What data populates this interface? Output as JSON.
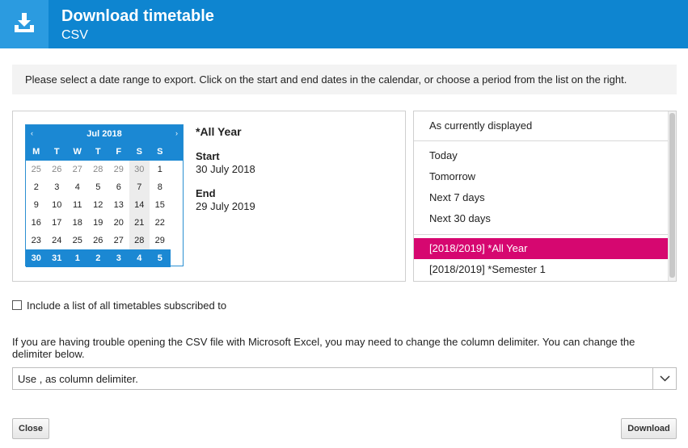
{
  "header": {
    "title": "Download timetable",
    "subtitle": "CSV",
    "icon": "download-tray-icon",
    "color": "#0e85d0"
  },
  "info": {
    "text": "Please select a date range to export. Click on the start and end dates in the calendar, or choose a period from the list on the right."
  },
  "calendar": {
    "month_label": "Jul 2018",
    "prev": "‹",
    "next": "›",
    "days_of_week": [
      "M",
      "T",
      "W",
      "T",
      "F",
      "S",
      "S"
    ],
    "weeks": [
      [
        "25",
        "26",
        "27",
        "28",
        "29",
        "30",
        "1"
      ],
      [
        "2",
        "3",
        "4",
        "5",
        "6",
        "7",
        "8"
      ],
      [
        "9",
        "10",
        "11",
        "12",
        "13",
        "14",
        "15"
      ],
      [
        "16",
        "17",
        "18",
        "19",
        "20",
        "21",
        "22"
      ],
      [
        "23",
        "24",
        "25",
        "26",
        "27",
        "28",
        "29"
      ],
      [
        "30",
        "31",
        "1",
        "2",
        "3",
        "4",
        "5"
      ]
    ],
    "accent": "#1b88d3"
  },
  "range": {
    "title": "*All Year",
    "start_label": "Start",
    "start_value": "30 July 2018",
    "end_label": "End",
    "end_value": "29 July 2019"
  },
  "periods": {
    "current": "As currently displayed",
    "relative": [
      "Today",
      "Tomorrow",
      "Next 7 days",
      "Next 30 days"
    ],
    "terms": [
      "[2018/2019] *All Year",
      "[2018/2019] *Semester 1"
    ],
    "selected_color": "#d60770"
  },
  "include": {
    "label": "Include a list of all timetables subscribed to",
    "checked": false
  },
  "help": {
    "text": "If you are having trouble opening the CSV file with Microsoft Excel, you may need to change the column delimiter. You can change the delimiter below."
  },
  "delimiter": {
    "value": "Use , as column delimiter."
  },
  "buttons": {
    "close": "Close",
    "download": "Download"
  }
}
